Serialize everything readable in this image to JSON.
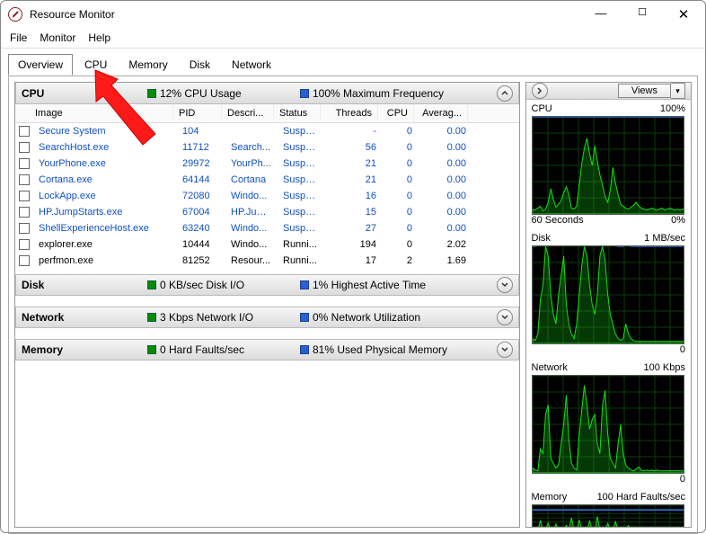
{
  "window": {
    "title": "Resource Monitor"
  },
  "menu": {
    "file": "File",
    "monitor": "Monitor",
    "help": "Help"
  },
  "tabs": {
    "overview": "Overview",
    "cpu": "CPU",
    "memory": "Memory",
    "disk": "Disk",
    "network": "Network"
  },
  "cpu_section": {
    "title": "CPU",
    "stat1": "12% CPU Usage",
    "stat2": "100% Maximum Frequency",
    "columns": {
      "image": "Image",
      "pid": "PID",
      "desc": "Descri...",
      "status": "Status",
      "threads": "Threads",
      "cpu": "CPU",
      "avg": "Averag..."
    },
    "rows": [
      {
        "link": true,
        "image": "Secure System",
        "pid": "104",
        "desc": "",
        "status": "Suspe...",
        "threads": "-",
        "cpu": "0",
        "avg": "0.00"
      },
      {
        "link": true,
        "image": "SearchHost.exe",
        "pid": "11712",
        "desc": "Search...",
        "status": "Suspe...",
        "threads": "56",
        "cpu": "0",
        "avg": "0.00"
      },
      {
        "link": true,
        "image": "YourPhone.exe",
        "pid": "29972",
        "desc": "YourPh...",
        "status": "Suspe...",
        "threads": "21",
        "cpu": "0",
        "avg": "0.00"
      },
      {
        "link": true,
        "image": "Cortana.exe",
        "pid": "64144",
        "desc": "Cortana",
        "status": "Suspe...",
        "threads": "21",
        "cpu": "0",
        "avg": "0.00"
      },
      {
        "link": true,
        "image": "LockApp.exe",
        "pid": "72080",
        "desc": "Windo...",
        "status": "Suspe...",
        "threads": "16",
        "cpu": "0",
        "avg": "0.00"
      },
      {
        "link": true,
        "image": "HP.JumpStarts.exe",
        "pid": "67004",
        "desc": "HP.Jum...",
        "status": "Suspe...",
        "threads": "15",
        "cpu": "0",
        "avg": "0.00"
      },
      {
        "link": true,
        "image": "ShellExperienceHost.exe",
        "pid": "63240",
        "desc": "Windo...",
        "status": "Suspe...",
        "threads": "27",
        "cpu": "0",
        "avg": "0.00"
      },
      {
        "link": false,
        "image": "explorer.exe",
        "pid": "10444",
        "desc": "Windo...",
        "status": "Runni...",
        "threads": "194",
        "cpu": "0",
        "avg": "2.02"
      },
      {
        "link": false,
        "image": "perfmon.exe",
        "pid": "81252",
        "desc": "Resour...",
        "status": "Runni...",
        "threads": "17",
        "cpu": "2",
        "avg": "1.69"
      }
    ]
  },
  "disk_section": {
    "title": "Disk",
    "stat1": "0 KB/sec Disk I/O",
    "stat2": "1% Highest Active Time"
  },
  "network_section": {
    "title": "Network",
    "stat1": "3 Kbps Network I/O",
    "stat2": "0% Network Utilization"
  },
  "memory_section": {
    "title": "Memory",
    "stat1": "0 Hard Faults/sec",
    "stat2": "81% Used Physical Memory"
  },
  "sidebar": {
    "views_label": "Views",
    "cpu": {
      "label": "CPU",
      "right": "100%",
      "bottom_left": "60 Seconds",
      "bottom_right": "0%"
    },
    "disk": {
      "label": "Disk",
      "right": "1 MB/sec",
      "bottom_left": "",
      "bottom_right": "0"
    },
    "network": {
      "label": "Network",
      "right": "100 Kbps",
      "bottom_left": "",
      "bottom_right": "0"
    },
    "memory": {
      "label": "Memory",
      "right": "100 Hard Faults/sec",
      "bottom_left": "",
      "bottom_right": ""
    }
  },
  "chart_data": [
    {
      "type": "area",
      "name": "CPU",
      "ylim": [
        0,
        100
      ],
      "xspan_seconds": 60,
      "series": [
        {
          "name": "cpu_usage_pct",
          "color": "#16e016",
          "values": [
            5,
            4,
            6,
            8,
            3,
            5,
            12,
            26,
            15,
            7,
            10,
            14,
            22,
            28,
            20,
            6,
            5,
            8,
            30,
            52,
            68,
            78,
            62,
            50,
            70,
            55,
            40,
            30,
            18,
            12,
            24,
            48,
            32,
            20,
            10,
            8,
            6,
            5,
            7,
            9,
            12,
            8,
            6,
            5,
            4,
            5,
            6,
            5,
            4,
            5,
            6,
            4,
            5,
            6,
            5,
            4,
            5,
            4,
            5,
            6
          ]
        },
        {
          "name": "max_frequency_pct",
          "color": "#2a6fe8",
          "values": [
            100,
            100,
            100,
            100,
            100,
            100,
            100,
            100,
            100,
            100,
            100,
            100,
            100,
            100,
            100,
            100,
            100,
            100,
            100,
            100,
            100,
            100,
            100,
            100,
            100,
            100,
            100,
            100,
            100,
            100,
            100,
            100,
            100,
            100,
            100,
            100,
            100,
            100,
            100,
            100,
            100,
            100,
            100,
            100,
            100,
            100,
            100,
            100,
            100,
            100,
            100,
            100,
            100,
            100,
            100,
            100,
            100,
            100,
            100,
            100
          ]
        }
      ]
    },
    {
      "type": "area",
      "name": "Disk",
      "ylim": [
        0,
        1
      ],
      "units": "MB/sec",
      "xspan_seconds": 60,
      "series": [
        {
          "name": "disk_io",
          "color": "#16e016",
          "values": [
            0.05,
            0.03,
            0.1,
            0.45,
            0.6,
            1.0,
            0.9,
            0.5,
            0.3,
            0.2,
            0.5,
            0.7,
            0.9,
            0.4,
            0.2,
            0.1,
            0.05,
            0.2,
            0.5,
            0.8,
            1.0,
            0.9,
            0.6,
            0.4,
            0.3,
            0.5,
            0.9,
            1.0,
            0.85,
            0.5,
            0.3,
            0.2,
            0.1,
            0.05,
            0.03,
            0.05,
            0.2,
            0.1,
            0.05,
            0.03,
            0.02,
            0.02,
            0.02,
            0.02,
            0.02,
            0.02,
            0.02,
            0.02,
            0.02,
            0.02,
            0.02,
            0.02,
            0.02,
            0.02,
            0.02,
            0.02,
            0.02,
            0.02,
            0.02,
            0.02
          ]
        },
        {
          "name": "active_time_pct",
          "color": "#2a6fe8",
          "values": [
            1,
            1,
            3,
            8,
            12,
            20,
            18,
            10,
            6,
            4,
            10,
            14,
            18,
            8,
            4,
            2,
            1,
            4,
            10,
            16,
            20,
            18,
            12,
            8,
            6,
            10,
            18,
            20,
            17,
            10,
            6,
            4,
            2,
            1,
            1,
            1,
            4,
            2,
            1,
            1,
            1,
            1,
            1,
            1,
            1,
            1,
            1,
            1,
            1,
            1,
            1,
            1,
            1,
            1,
            1,
            1,
            1,
            1,
            1,
            1
          ]
        }
      ]
    },
    {
      "type": "area",
      "name": "Network",
      "ylim": [
        0,
        100
      ],
      "units": "Kbps",
      "xspan_seconds": 60,
      "series": [
        {
          "name": "network_io",
          "color": "#16e016",
          "values": [
            5,
            3,
            2,
            25,
            20,
            60,
            70,
            15,
            10,
            5,
            8,
            30,
            50,
            80,
            35,
            10,
            5,
            3,
            40,
            65,
            90,
            70,
            45,
            55,
            60,
            30,
            20,
            70,
            85,
            40,
            15,
            10,
            5,
            30,
            50,
            20,
            8,
            5,
            3,
            2,
            4,
            6,
            3,
            2,
            3,
            2,
            3,
            2,
            3,
            2,
            2,
            2,
            2,
            2,
            2,
            2,
            2,
            2,
            2,
            2
          ]
        }
      ]
    },
    {
      "type": "area",
      "name": "Memory",
      "ylim": [
        0,
        100
      ],
      "units": "Hard Faults/sec",
      "xspan_seconds": 60,
      "series": [
        {
          "name": "hard_faults",
          "color": "#16e016",
          "values": [
            0,
            0,
            0,
            40,
            0,
            0,
            30,
            0,
            0,
            25,
            0,
            0,
            0,
            20,
            0,
            50,
            0,
            0,
            42,
            0,
            0,
            0,
            38,
            0,
            0,
            55,
            0,
            0,
            0,
            28,
            0,
            0,
            35,
            0,
            0,
            0,
            0,
            20,
            0,
            0,
            0,
            0,
            0,
            0,
            0,
            0,
            0,
            0,
            0,
            0,
            0,
            0,
            0,
            0,
            0,
            0,
            0,
            0,
            0,
            0
          ]
        },
        {
          "name": "used_physical_memory_pct",
          "color": "#2a6fe8",
          "values": [
            81,
            81,
            81,
            81,
            81,
            81,
            81,
            81,
            81,
            81,
            81,
            81,
            81,
            81,
            81,
            81,
            81,
            81,
            81,
            81,
            81,
            81,
            81,
            81,
            81,
            81,
            81,
            81,
            81,
            81,
            81,
            81,
            81,
            81,
            81,
            81,
            81,
            81,
            81,
            81,
            81,
            81,
            81,
            81,
            81,
            81,
            81,
            81,
            81,
            81,
            81,
            81,
            81,
            81,
            81,
            81,
            81,
            81,
            81,
            81
          ]
        }
      ]
    }
  ]
}
